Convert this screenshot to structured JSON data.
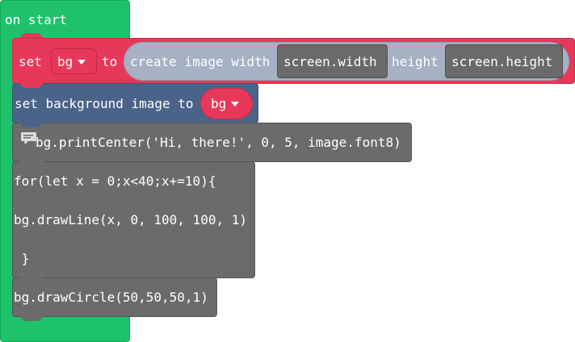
{
  "on_start": {
    "label": "on start"
  },
  "set_block": {
    "set_label": "set",
    "var_name": "bg",
    "to_label": "to",
    "create_label": "create image width",
    "width_value": "screen.width",
    "height_label": "height",
    "height_value": "screen.height"
  },
  "bg_block": {
    "label": "set background image to",
    "var_name": "bg"
  },
  "print_block": {
    "code": "bg.printCenter('Hi, there!', 0, 5, image.font8)"
  },
  "for_block": {
    "line1": "for(let x = 0;x<40;x+=10){",
    "line2": "bg.drawLine(x, 0, 100, 100, 1)",
    "line3": " }"
  },
  "circle_block": {
    "code": "bg.drawCircle(50,50,50,1)"
  },
  "colors": {
    "event_green": "#1ec26b",
    "variable_red": "#e8385a",
    "scene_blue": "#4a6489",
    "code_grey": "#6c6b6b",
    "image_oval": "#a6b1c3"
  }
}
